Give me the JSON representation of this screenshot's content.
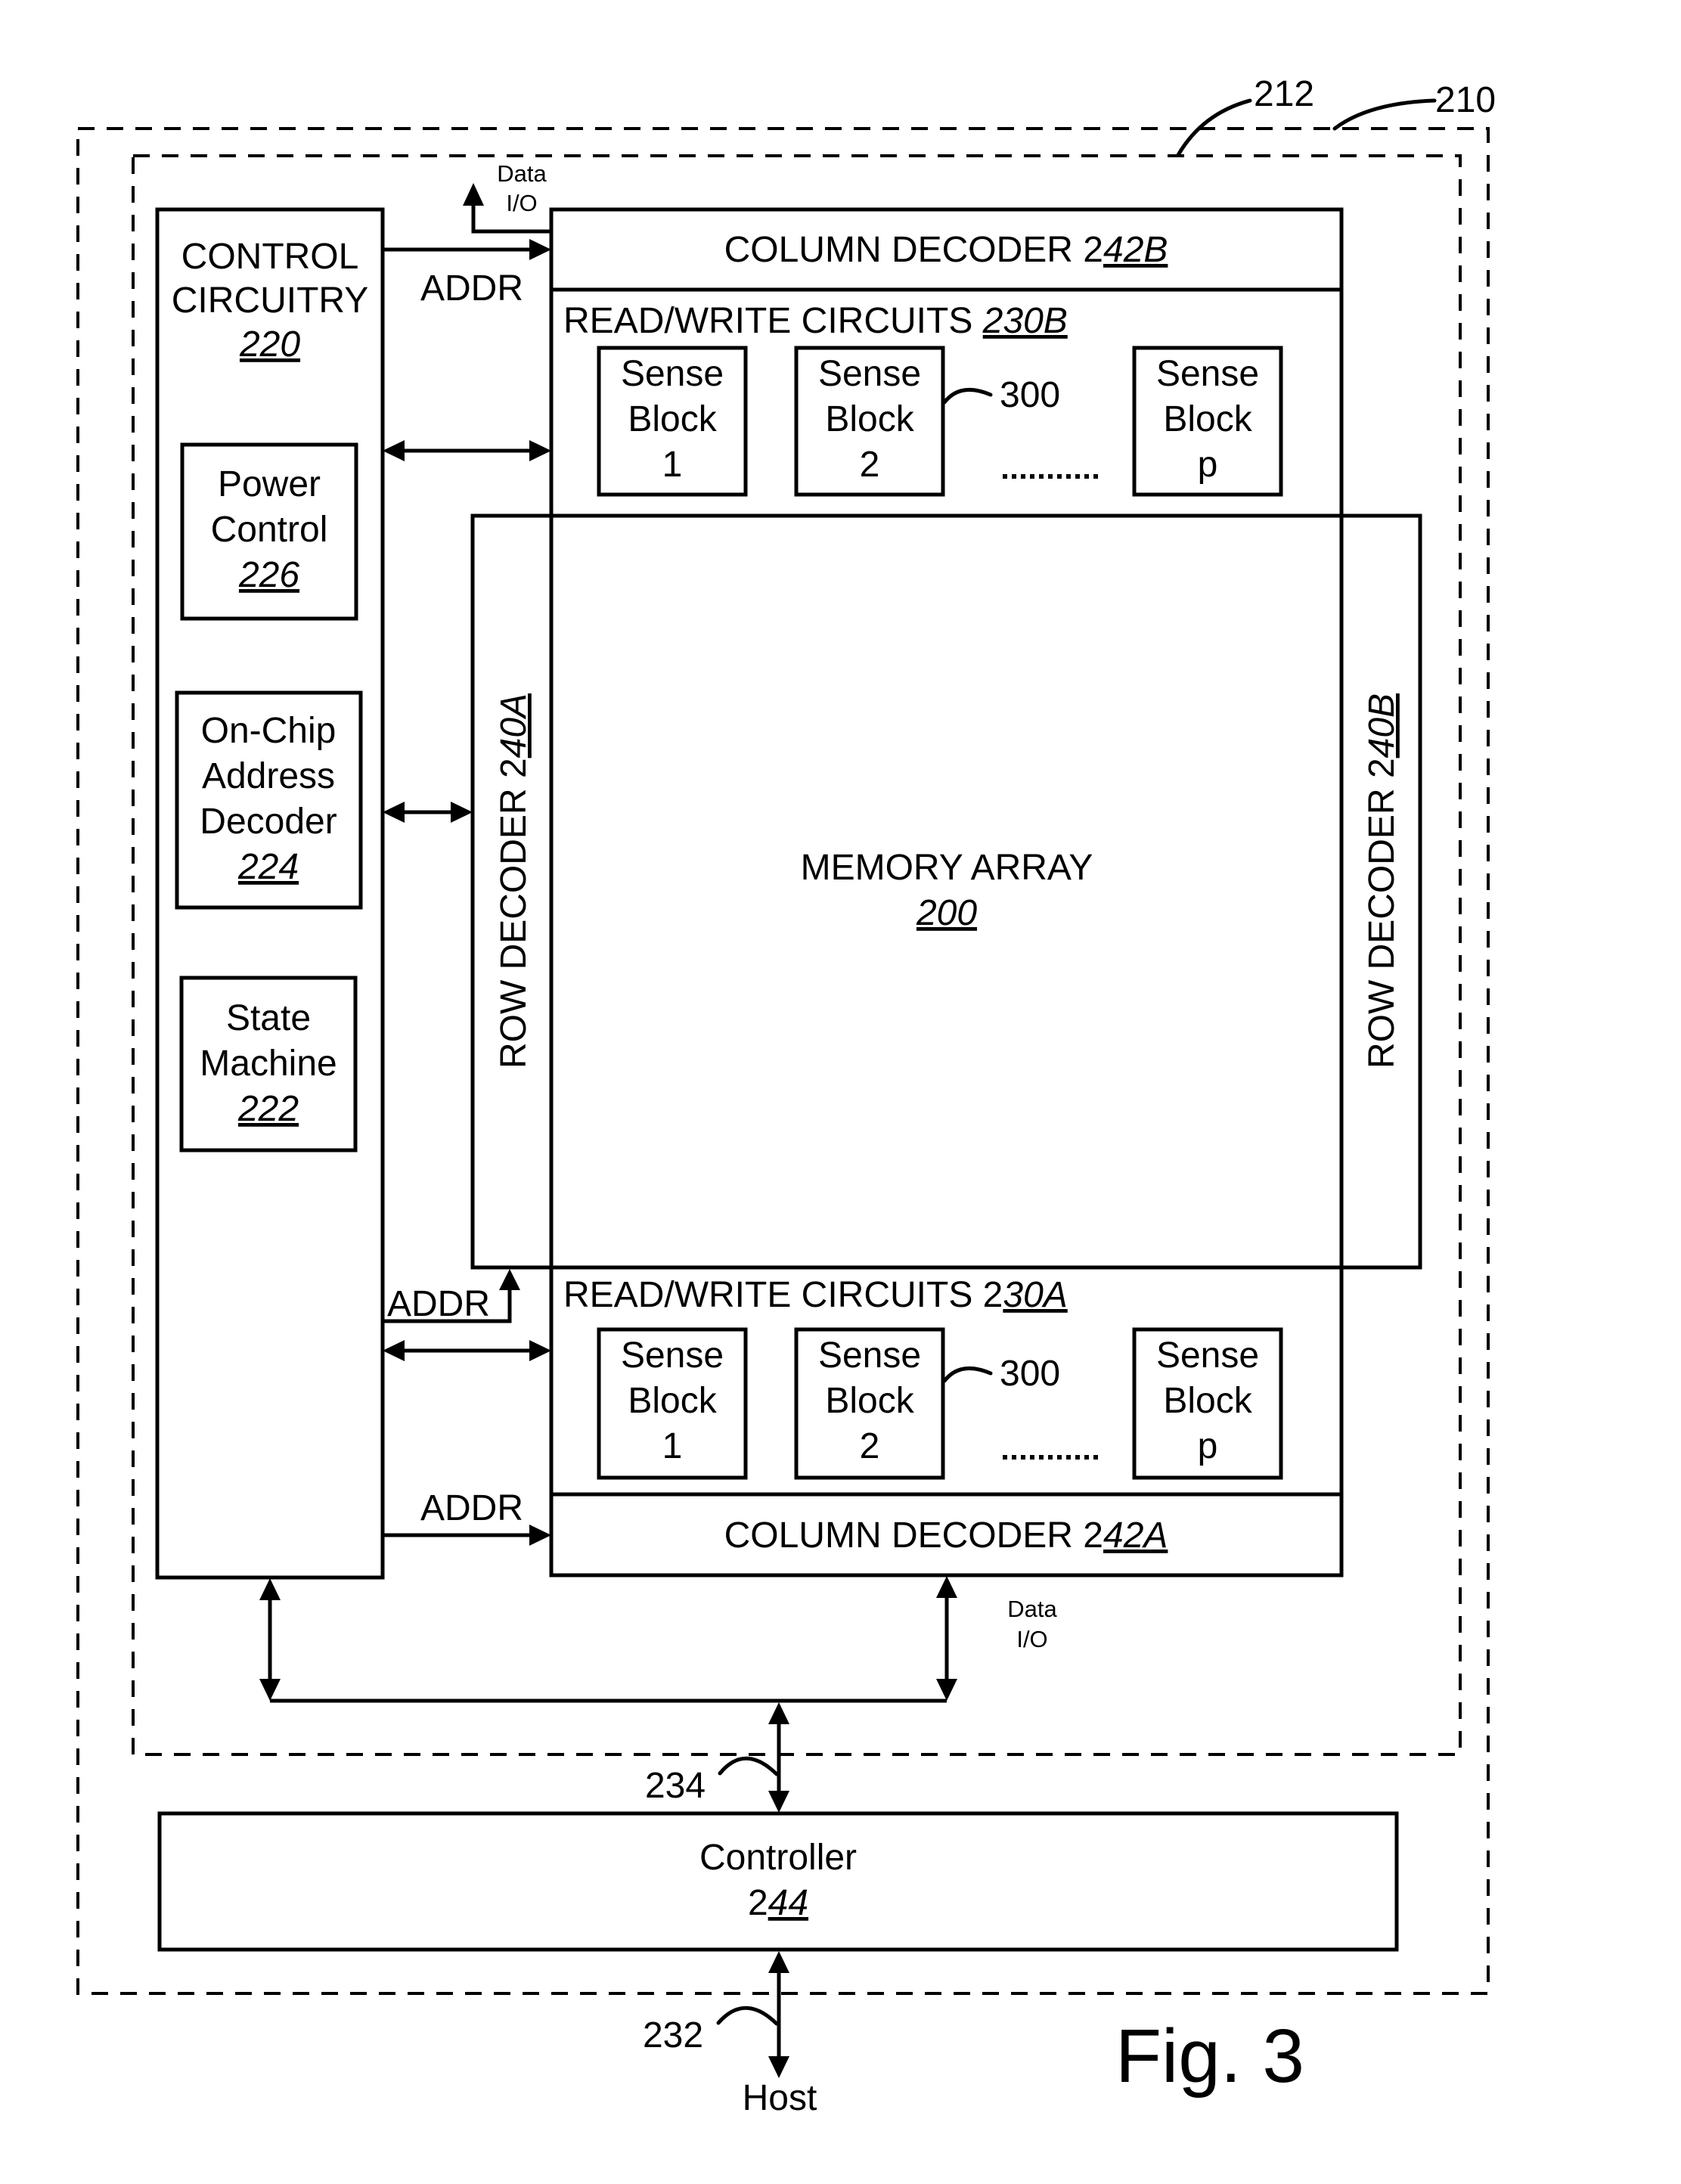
{
  "figure": {
    "caption": "Fig. 3",
    "ref_outer": "210",
    "ref_inner": "212"
  },
  "control_circuitry": {
    "line1": "CONTROL",
    "line2": "CIRCUITRY",
    "ref": "220"
  },
  "power_control": {
    "line1": "Power",
    "line2": "Control",
    "ref": "226"
  },
  "address_decoder": {
    "line1": "On-Chip",
    "line2": "Address",
    "line3": "Decoder",
    "ref": "224"
  },
  "state_machine": {
    "line1": "State",
    "line2": "Machine",
    "ref": "222"
  },
  "column_decoder_b": {
    "label": "COLUMN DECODER 2",
    "ref": "42B"
  },
  "column_decoder_a": {
    "label": "COLUMN DECODER 2",
    "ref": "42A"
  },
  "rw_circuits_b": {
    "label": "READ/WRITE CIRCUITS ",
    "ref": "230B"
  },
  "rw_circuits_a": {
    "label": "READ/WRITE CIRCUITS 2",
    "ref": "30A"
  },
  "sense_blocks": {
    "word1": "Sense",
    "word2": "Block",
    "ids": [
      "1",
      "2",
      "p"
    ],
    "ref": "300",
    "ellipsis": "........."
  },
  "row_decoder_a": {
    "label": "ROW DECODER 2",
    "ref": "40A"
  },
  "row_decoder_b": {
    "label": "ROW DECODER 2",
    "ref": "40B"
  },
  "memory_array": {
    "label": "MEMORY ARRAY",
    "ref": "200"
  },
  "signals": {
    "addr": "ADDR",
    "data_line1": "Data",
    "data_line2": "I/O"
  },
  "controller": {
    "label": "Controller",
    "prefix": "2",
    "ref": "44"
  },
  "bus_internal": {
    "ref": "234"
  },
  "bus_host": {
    "ref": "232",
    "label": "Host"
  }
}
